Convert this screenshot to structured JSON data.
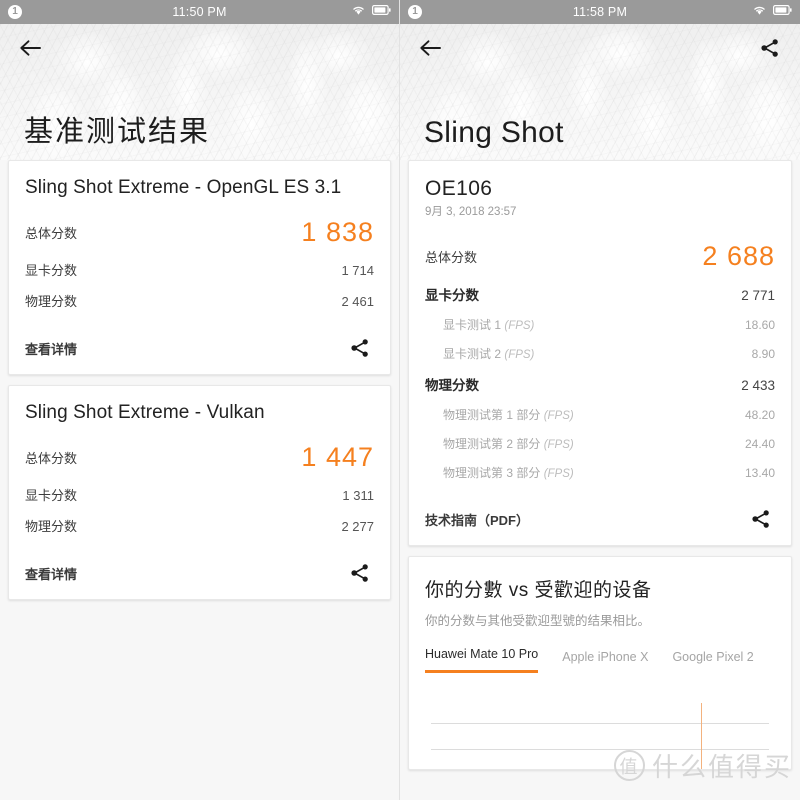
{
  "left_screen": {
    "statusbar": {
      "notif_count": "1",
      "time": "11:50 PM",
      "wifi_icon": "wifi-icon",
      "battery_icon": "battery-icon"
    },
    "header": {
      "back_icon": "back-arrow-icon",
      "title": "基准测试结果"
    },
    "cards": [
      {
        "title": "Sling Shot Extreme - OpenGL ES 3.1",
        "rows": [
          {
            "label": "总体分数",
            "value": "1 838",
            "kind": "total"
          },
          {
            "label": "显卡分数",
            "value": "1 714",
            "kind": "normal"
          },
          {
            "label": "物理分数",
            "value": "2 461",
            "kind": "normal"
          }
        ],
        "footer_link": "查看详情",
        "share_icon": "share-icon"
      },
      {
        "title": "Sling Shot Extreme - Vulkan",
        "rows": [
          {
            "label": "总体分数",
            "value": "1 447",
            "kind": "total"
          },
          {
            "label": "显卡分数",
            "value": "1 311",
            "kind": "normal"
          },
          {
            "label": "物理分数",
            "value": "2 277",
            "kind": "normal"
          }
        ],
        "footer_link": "查看详情",
        "share_icon": "share-icon"
      }
    ]
  },
  "right_screen": {
    "statusbar": {
      "notif_count": "1",
      "time": "11:58 PM",
      "wifi_icon": "wifi-icon",
      "battery_icon": "battery-icon"
    },
    "header": {
      "back_icon": "back-arrow-icon",
      "share_icon": "share-icon",
      "title": "Sling Shot"
    },
    "result_card": {
      "device": "OE106",
      "date": "9月 3, 2018 23:57",
      "rows": [
        {
          "label": "总体分数",
          "value": "2 688",
          "kind": "total"
        },
        {
          "label": "显卡分数",
          "value": "2 771",
          "kind": "bold"
        },
        {
          "label": "显卡测试 1",
          "unit": "(FPS)",
          "value": "18.60",
          "kind": "sub"
        },
        {
          "label": "显卡测试 2",
          "unit": "(FPS)",
          "value": "8.90",
          "kind": "sub"
        },
        {
          "label": "物理分数",
          "value": "2 433",
          "kind": "bold"
        },
        {
          "label": "物理测试第 1 部分",
          "unit": "(FPS)",
          "value": "48.20",
          "kind": "sub"
        },
        {
          "label": "物理测试第 2 部分",
          "unit": "(FPS)",
          "value": "24.40",
          "kind": "sub"
        },
        {
          "label": "物理测试第 3 部分",
          "unit": "(FPS)",
          "value": "13.40",
          "kind": "sub"
        }
      ],
      "footer_link": "技术指南（PDF）",
      "share_icon": "share-icon"
    },
    "comparison": {
      "title": "你的分數 vs 受歡迎的设备",
      "subtitle": "你的分数与其他受歡迎型號的结果相比。",
      "tabs": [
        {
          "label": "Huawei Mate 10 Pro",
          "active": true
        },
        {
          "label": "Apple iPhone X",
          "active": false
        },
        {
          "label": "Google Pixel 2",
          "active": false
        }
      ]
    }
  },
  "watermark": {
    "mark": "值",
    "text": "什么值得买"
  },
  "colors": {
    "accent": "#f5801f",
    "statusbar": "#9a9a9a",
    "page_bg": "#f7f7f7",
    "card_bg": "#ffffff"
  }
}
